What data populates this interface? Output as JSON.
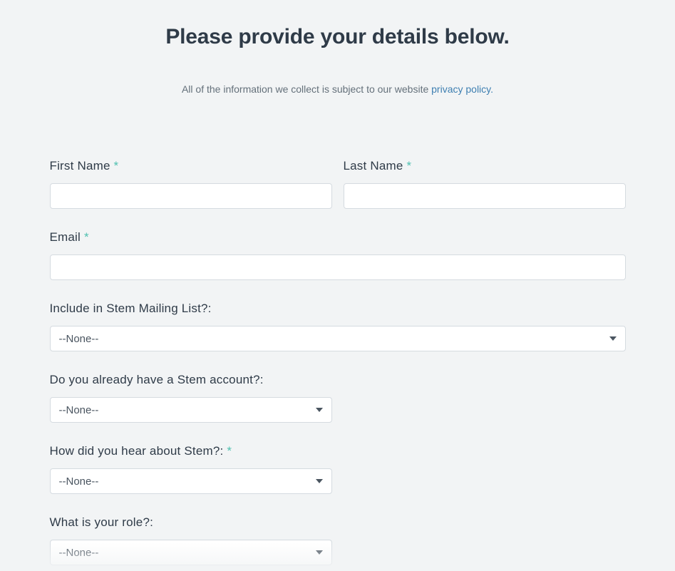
{
  "header": {
    "title": "Please provide your details below.",
    "sub_prefix": "All of the information we collect is subject to our website ",
    "privacy_link": "privacy policy."
  },
  "form": {
    "first_name": {
      "label": "First Name ",
      "value": ""
    },
    "last_name": {
      "label": "Last Name ",
      "value": ""
    },
    "email": {
      "label": "Email ",
      "value": ""
    },
    "mailing_list": {
      "label": "Include in Stem Mailing List?:",
      "selected": "--None--"
    },
    "has_account": {
      "label": "Do you already have a Stem account?:",
      "selected": "--None--"
    },
    "heard_about": {
      "label": "How did you hear about Stem?: ",
      "selected": "--None--"
    },
    "role": {
      "label": "What is your role?:",
      "selected": "--None--"
    },
    "required_marker": "*"
  }
}
